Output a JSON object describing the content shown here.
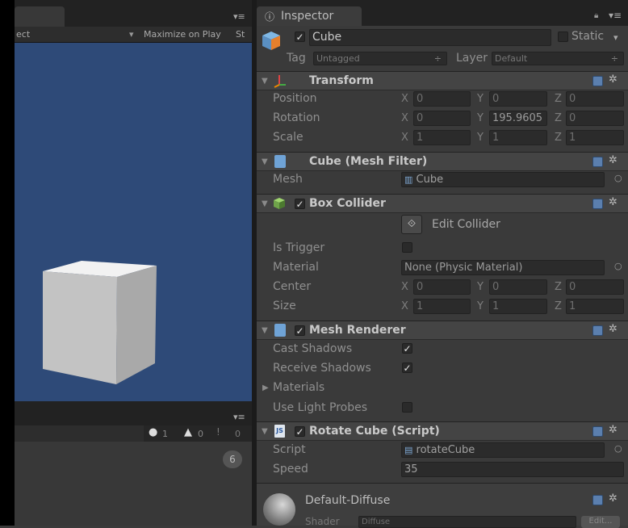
{
  "game_panel": {
    "toolbar_left": "ect",
    "maximize": "Maximize on Play",
    "stats_cut": "St",
    "menu": "▾≡"
  },
  "console": {
    "menu": "▾≡",
    "errors": "1",
    "warnings": "0",
    "logs": "0",
    "badge": "6"
  },
  "inspector": {
    "tab_label": "Inspector",
    "menu": "▾≡",
    "object": {
      "name": "Cube",
      "static_label": "Static",
      "tag_label": "Tag",
      "tag_value": "Untagged",
      "layer_label": "Layer",
      "layer_value": "Default"
    },
    "transform": {
      "title": "Transform",
      "position_label": "Position",
      "rotation_label": "Rotation",
      "scale_label": "Scale",
      "x": "X",
      "y": "Y",
      "z": "Z",
      "pos": [
        "0",
        "0",
        "0"
      ],
      "rot": [
        "0",
        "195.9605",
        "0"
      ],
      "scl": [
        "1",
        "1",
        "1"
      ]
    },
    "mesh_filter": {
      "title": "Cube (Mesh Filter)",
      "mesh_label": "Mesh",
      "mesh_value": "Cube"
    },
    "box_collider": {
      "title": "Box Collider",
      "edit_collider": "Edit Collider",
      "is_trigger_label": "Is Trigger",
      "material_label": "Material",
      "material_value": "None (Physic Material)",
      "center_label": "Center",
      "size_label": "Size",
      "center": [
        "0",
        "0",
        "0"
      ],
      "size": [
        "1",
        "1",
        "1"
      ]
    },
    "mesh_renderer": {
      "title": "Mesh Renderer",
      "cast_shadows_label": "Cast Shadows",
      "receive_shadows_label": "Receive Shadows",
      "materials_label": "Materials",
      "light_probes_label": "Use Light Probes"
    },
    "rotate_cube": {
      "title": "Rotate Cube (Script)",
      "script_label": "Script",
      "script_value": "rotateCube",
      "speed_label": "Speed",
      "speed_value": "35"
    },
    "material": {
      "title": "Default-Diffuse",
      "shader_label": "Shader",
      "shader_value": "Diffuse",
      "edit": "Edit..."
    }
  },
  "colors": {
    "game_bg": "#2e4a78",
    "panel_bg": "#3a3a3a",
    "header_bg": "#444444"
  }
}
